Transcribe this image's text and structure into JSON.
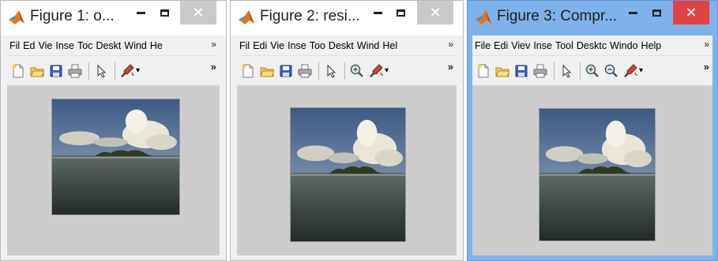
{
  "windows": [
    {
      "title": "Figure 1: o...",
      "menus": [
        "Fil",
        "Ed",
        "Vie",
        "Inse",
        "Toc",
        "Deskt",
        "Wind",
        "He"
      ],
      "menu_overflow": "»",
      "toolbar": [
        "new-file-icon",
        "open-folder-icon",
        "save-icon",
        "print-icon",
        "arrow-pointer-icon",
        "brush-icon"
      ],
      "toolbar_overflow": "»",
      "close_glyph": "✕"
    },
    {
      "title": "Figure 2: resi...",
      "menus": [
        "Fil",
        "Edi",
        "Vie",
        "Inse",
        "Too",
        "Deskt",
        "Wind",
        "Hel"
      ],
      "menu_overflow": "»",
      "toolbar": [
        "new-file-icon",
        "open-folder-icon",
        "save-icon",
        "print-icon",
        "arrow-pointer-icon",
        "zoom-in-icon",
        "brush-icon"
      ],
      "toolbar_overflow": "»",
      "close_glyph": "✕"
    },
    {
      "title": "Figure 3: Compr...",
      "menus": [
        "File",
        "Edi",
        "Viev",
        "Inse",
        "Tool",
        "Desktc",
        "Windo",
        "Help"
      ],
      "menu_overflow": "»",
      "toolbar": [
        "new-file-icon",
        "open-folder-icon",
        "save-icon",
        "print-icon",
        "arrow-pointer-icon",
        "zoom-in-icon",
        "zoom-out-icon",
        "brush-icon"
      ],
      "toolbar_overflow": "»",
      "close_glyph": "✕"
    }
  ],
  "colors": {
    "active_title": "#7fb2ea",
    "inactive_title": "#ffffff",
    "active_close": "#e04343",
    "client_bg": "#cdcdcd"
  }
}
